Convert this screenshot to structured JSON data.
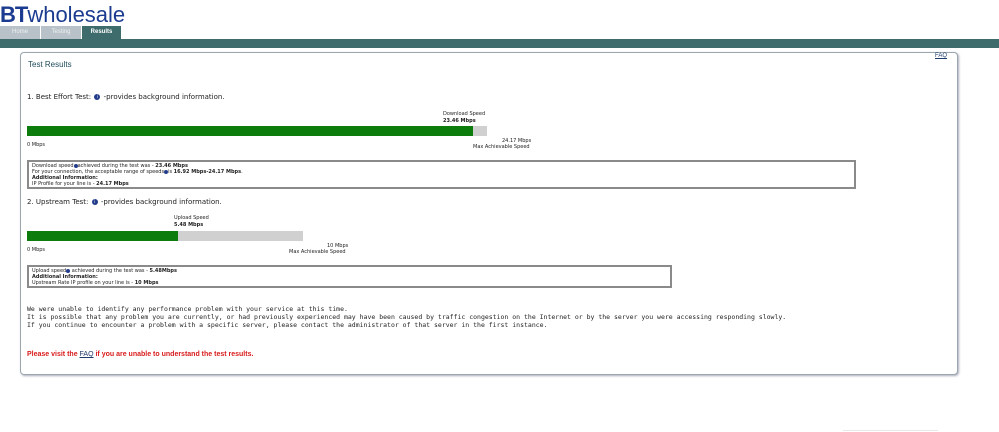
{
  "brand": {
    "logo_bt": "BT",
    "logo_rest": "wholesale"
  },
  "tabs": [
    {
      "label": "Home",
      "active": false
    },
    {
      "label": "Testing",
      "active": false
    },
    {
      "label": "Results",
      "active": true
    }
  ],
  "colors": {
    "brand_teal": "#3e6b6b",
    "bar_fill": "#0c7d0c",
    "bar_track": "#d0d0d0",
    "warning": "#d81b1b"
  },
  "page": {
    "title": "Test Results",
    "faq_link": "FAQ"
  },
  "best_effort": {
    "heading_prefix": "1. Best Effort Test:",
    "heading_suffix": "-provides background information.",
    "speed_label": "Download Speed",
    "speed_value": "23.46 Mbps",
    "min_label": "0 Mbps",
    "max_value": "24.17 Mbps",
    "max_label": "Max Achievable Speed",
    "fill_fraction": 0.9706,
    "info": {
      "line1_a": "Download speed",
      "line1_b": "achieved during the test was - ",
      "line1_value": "23.46 Mbps",
      "line2_a": "For your connection, the acceptable range of speeds",
      "line2_b": "is ",
      "line2_value": "16.92 Mbps-24.17 Mbps",
      "line2_end": ".",
      "line3": "Additional Information:",
      "line4_a": "IP Profile for your line is - ",
      "line4_value": "24.17 Mbps"
    }
  },
  "upstream": {
    "heading_prefix": "2. Upstream Test:",
    "heading_suffix": "-provides background information.",
    "speed_label": "Upload Speed",
    "speed_value": "5.48 Mbps",
    "min_label": "0 Mbps",
    "max_value": "10 Mbps",
    "max_label": "Max Achievable Speed",
    "fill_fraction": 0.548,
    "info": {
      "line1_a": "Upload speed",
      "line1_b": " achieved during the test was - ",
      "line1_value": "5.48Mbps",
      "line2": "Additional Information:",
      "line3_a": "Upstream Rate IP profile on your line is - ",
      "line3_value": "10 Mbps"
    }
  },
  "message": {
    "line1": "We were unable to identify any performance problem with your service at this time.",
    "line2": "It is possible that any problem you are currently, or had previously experienced may have been caused by traffic congestion on the Internet or by the server you were accessing responding slowly.",
    "line3": "If you continue to encounter a problem with a specific server, please contact the administrator of that server in the first instance."
  },
  "warning": {
    "prefix": "Please visit the ",
    "link": "FAQ",
    "suffix": " if you are unable to understand the test results."
  }
}
